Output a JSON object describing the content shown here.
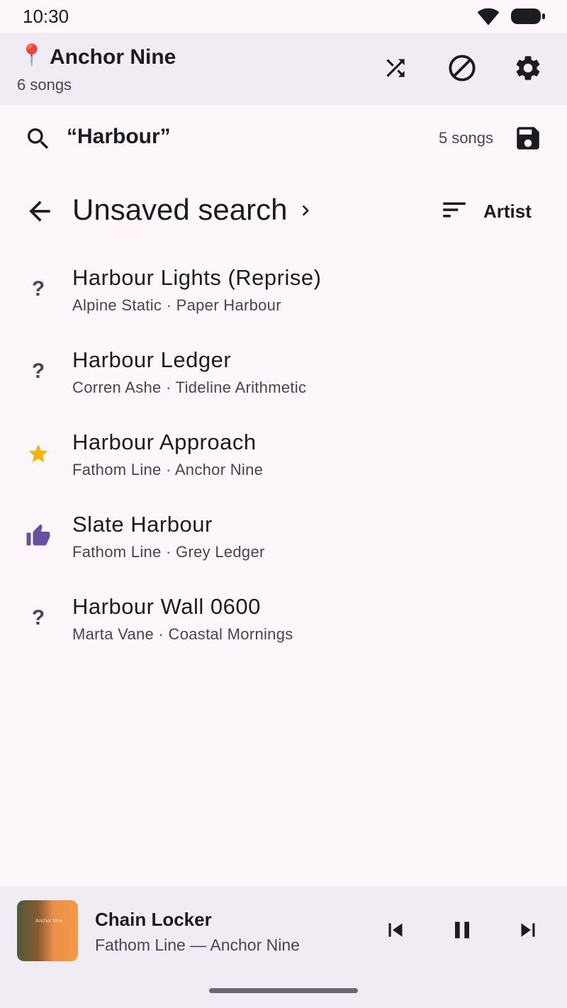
{
  "status_bar": {
    "time": "10:30"
  },
  "top_bar": {
    "pin_emoji": "📍",
    "title": "Anchor Nine",
    "count": "6 songs",
    "actions": [
      "shuffle-icon",
      "block-icon",
      "gear-icon"
    ]
  },
  "search": {
    "query": "“Harbour”",
    "count": "5 songs"
  },
  "header": {
    "title": "Unsaved search",
    "sort_label": "Artist"
  },
  "songs": [
    {
      "title": "Harbour Lights (Reprise)",
      "subtitle": "Alpine Static · Paper Harbour",
      "rating": "unrated",
      "rating_glyph": "?"
    },
    {
      "title": "Harbour Ledger",
      "subtitle": "Corren Ashe · Tideline Arithmetic",
      "rating": "unrated",
      "rating_glyph": "?"
    },
    {
      "title": "Harbour Approach",
      "subtitle": "Fathom Line · Anchor Nine",
      "rating": "star",
      "rating_glyph": ""
    },
    {
      "title": "Slate Harbour",
      "subtitle": "Fathom Line · Grey Ledger",
      "rating": "thumbs-up",
      "rating_glyph": ""
    },
    {
      "title": "Harbour Wall 0600",
      "subtitle": "Marta Vane · Coastal Mornings",
      "rating": "unrated",
      "rating_glyph": "?"
    }
  ],
  "now_playing": {
    "title": "Chain Locker",
    "subtitle": "Fathom Line — Anchor Nine",
    "art_text": "Anchor Nine"
  },
  "colors": {
    "star": "#f6b400",
    "thumb": "#6750a4",
    "bar_bg": "#f1ebf4",
    "page_bg": "#fdf7fc"
  }
}
